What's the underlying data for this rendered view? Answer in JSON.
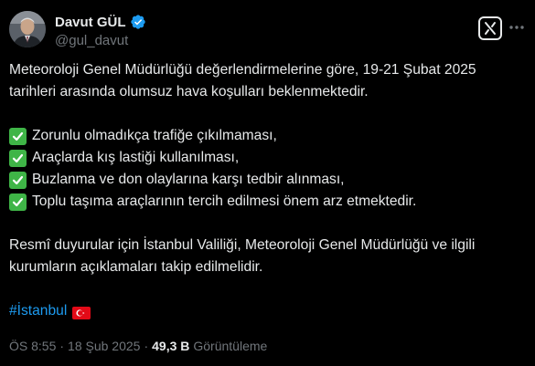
{
  "author": {
    "display_name": "Davut GÜL",
    "handle": "@gul_davut"
  },
  "tweet": {
    "intro": "Meteoroloji Genel Müdürlüğü değerlendirmelerine göre, 19-21 Şubat 2025 tarihleri arasında olumsuz hava koşulları beklenmektedir.",
    "items": [
      "Zorunlu olmadıkça trafiğe çıkılmaması,",
      "Araçlarda kış lastiği kullanılması,",
      "Buzlanma ve don olaylarına karşı tedbir alınması,",
      "Toplu taşıma araçlarının tercih edilmesi önem arz etmektedir."
    ],
    "closing": "Resmî duyurular için İstanbul Valiliği, Meteoroloji Genel Müdürlüğü ve ilgili kurumların açıklamaları takip edilmelidir.",
    "hashtag": "#İstanbul",
    "flag_icon": "turkey-flag-icon"
  },
  "meta": {
    "time": "ÖS 8:55",
    "separator": "·",
    "date": "18 Şub 2025",
    "separator2": "·",
    "views_count": "49,3 B",
    "views_label": "Görüntüleme"
  },
  "colors": {
    "background": "#000000",
    "text": "#e7e9ea",
    "muted": "#71767b",
    "link": "#1d9bf0",
    "verified": "#1d9bf0",
    "check": "#3fb547"
  }
}
